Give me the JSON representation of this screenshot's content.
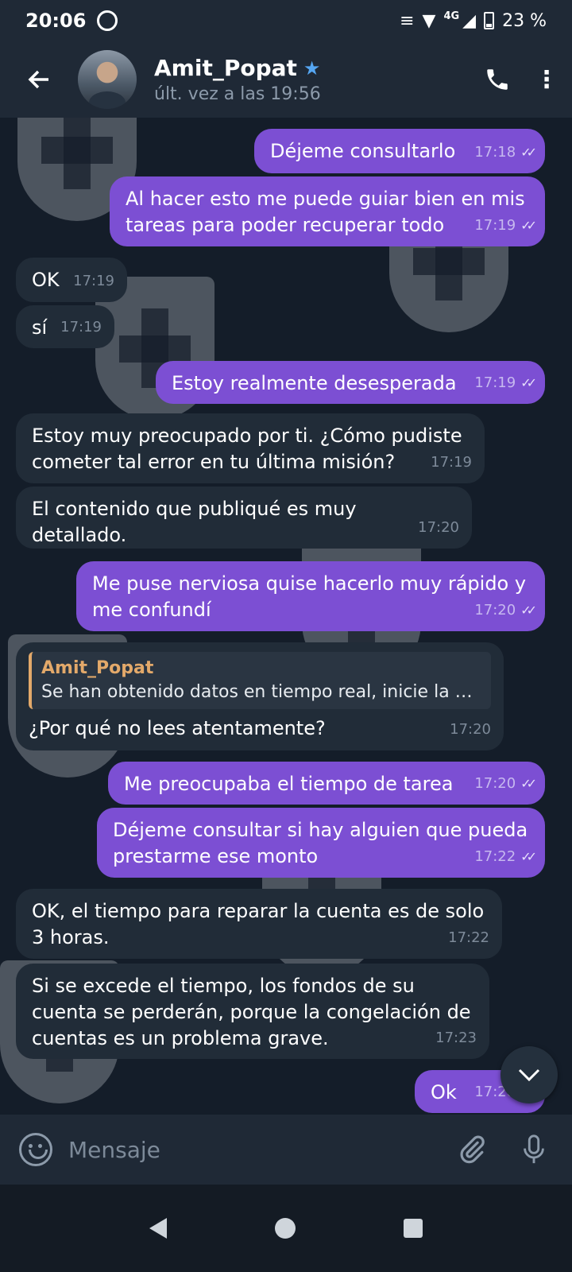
{
  "status_bar": {
    "time": "20:06",
    "network": "4G",
    "battery": "23 %"
  },
  "header": {
    "name": "Amit_Popat",
    "last_seen": "últ. vez a las 19:56"
  },
  "messages": [
    {
      "dir": "out",
      "text": "Déjeme consultarlo",
      "time": "17:18"
    },
    {
      "dir": "out",
      "text": "Al hacer esto me puede guiar bien en mis tareas para poder recuperar todo",
      "time": "17:19"
    },
    {
      "dir": "in",
      "text": "OK",
      "time": "17:19"
    },
    {
      "dir": "in",
      "text": "sí",
      "time": "17:19"
    },
    {
      "dir": "out",
      "text": "Estoy realmente desesperada",
      "time": "17:19"
    },
    {
      "dir": "in",
      "text": "Estoy muy preocupado por ti. ¿Cómo pudiste cometer tal error en tu última misión?",
      "time": "17:19"
    },
    {
      "dir": "in",
      "text": "El contenido que publiqué es muy detallado.",
      "time": "17:20"
    },
    {
      "dir": "out",
      "text": "Me puse nerviosa quise hacerlo muy rápido y me confundí",
      "time": "17:20"
    },
    {
      "dir": "in",
      "reply_name": "Amit_Popat",
      "reply_text": "Se han obtenido datos en tiempo real, inicie la op…",
      "text": "¿Por qué no lees atentamente?",
      "time": "17:20"
    },
    {
      "dir": "out",
      "text": "Me preocupaba el tiempo de tarea",
      "time": "17:20"
    },
    {
      "dir": "out",
      "text": "Déjeme consultar si hay alguien que pueda prestarme ese monto",
      "time": "17:22"
    },
    {
      "dir": "in",
      "text": "OK, el tiempo para reparar la cuenta es de solo 3 horas.",
      "time": "17:22"
    },
    {
      "dir": "in",
      "text": "Si se excede el tiempo, los fondos de su cuenta se perderán, porque la congelación de cuentas es un problema grave.",
      "time": "17:23"
    },
    {
      "dir": "out",
      "text": "Ok",
      "time": "17:28"
    }
  ],
  "input": {
    "placeholder": "Mensaje"
  },
  "colors": {
    "outgoing_bubble": "#7c4fd3",
    "incoming_bubble": "#212c38",
    "background": "#141d29",
    "header": "#1f2936",
    "reply_accent": "#e3a96a",
    "verified_star": "#55a6f2"
  },
  "icons": [
    "back-arrow-icon",
    "verified-star-icon",
    "phone-icon",
    "more-vert-icon",
    "scroll-down-icon",
    "emoji-icon",
    "attach-icon",
    "mic-icon"
  ]
}
